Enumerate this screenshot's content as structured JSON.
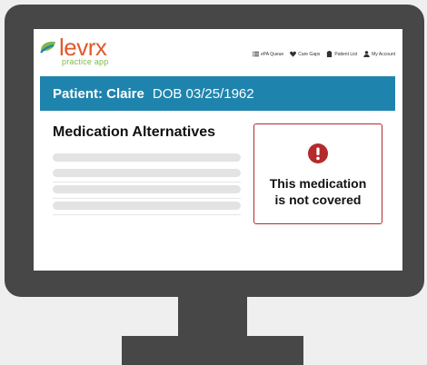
{
  "app": {
    "logo_text": "levrx",
    "logo_subtitle": "practice app"
  },
  "nav": {
    "items": [
      {
        "label": "ePA Queue",
        "icon": "list-icon"
      },
      {
        "label": "Care Gaps",
        "icon": "heart-icon"
      },
      {
        "label": "Patient List",
        "icon": "clipboard-icon"
      },
      {
        "label": "My Account",
        "icon": "user-icon"
      }
    ]
  },
  "patient": {
    "name_label": "Patient: Claire",
    "dob_label": "DOB 03/25/1962"
  },
  "main": {
    "section_title": "Medication Alternatives"
  },
  "alert": {
    "icon": "exclamation-circle-icon",
    "line1": "This medication",
    "line2": "is not covered"
  },
  "colors": {
    "brand_orange": "#e15a2a",
    "brand_green": "#7db94a",
    "patient_bar": "#1f84ad",
    "alert_red": "#b42b2d",
    "monitor": "#474747"
  }
}
